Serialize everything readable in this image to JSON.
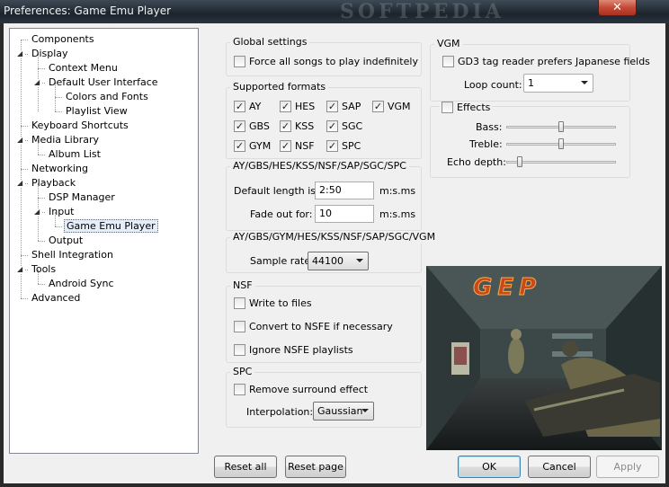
{
  "window": {
    "title": "Preferences: Game Emu Player",
    "watermark": "SOFTPEDIA",
    "close_icon": "close-icon"
  },
  "tree": {
    "items": [
      {
        "label": "Components"
      },
      {
        "label": "Display",
        "expanded": true
      },
      {
        "label": "Context Menu"
      },
      {
        "label": "Default User Interface",
        "expanded": true
      },
      {
        "label": "Colors and Fonts"
      },
      {
        "label": "Playlist View"
      },
      {
        "label": "Keyboard Shortcuts"
      },
      {
        "label": "Media Library",
        "expanded": true
      },
      {
        "label": "Album List"
      },
      {
        "label": "Networking"
      },
      {
        "label": "Playback",
        "expanded": true
      },
      {
        "label": "DSP Manager"
      },
      {
        "label": "Input",
        "expanded": true
      },
      {
        "label": "Game Emu Player",
        "selected": true
      },
      {
        "label": "Output"
      },
      {
        "label": "Shell Integration"
      },
      {
        "label": "Tools",
        "expanded": true
      },
      {
        "label": "Android Sync"
      },
      {
        "label": "Advanced"
      }
    ]
  },
  "global": {
    "title": "Global settings",
    "force_label": "Force all songs to play indefinitely",
    "force_checked": false
  },
  "formats": {
    "title": "Supported formats",
    "items": [
      {
        "label": "AY",
        "checked": true
      },
      {
        "label": "HES",
        "checked": true
      },
      {
        "label": "SAP",
        "checked": true
      },
      {
        "label": "VGM",
        "checked": true
      },
      {
        "label": "GBS",
        "checked": true
      },
      {
        "label": "KSS",
        "checked": true
      },
      {
        "label": "SGC",
        "checked": true
      },
      {
        "label": "GYM",
        "checked": true
      },
      {
        "label": "NSF",
        "checked": true
      },
      {
        "label": "SPC",
        "checked": true
      }
    ]
  },
  "length": {
    "title": "AY/GBS/HES/KSS/NSF/SAP/SGC/SPC",
    "default_label": "Default length is:",
    "default_value": "2:50",
    "fade_label": "Fade out for:",
    "fade_value": "10",
    "unit": "m:s.ms"
  },
  "rate": {
    "title": "AY/GBS/GYM/HES/KSS/NSF/SAP/SGC/VGM",
    "label": "Sample rate:",
    "value": "44100"
  },
  "nsf": {
    "title": "NSF",
    "write_label": "Write to files",
    "convert_label": "Convert to NSFE if necessary",
    "ignore_label": "Ignore NSFE playlists"
  },
  "spc": {
    "title": "SPC",
    "surround_label": "Remove surround effect",
    "interp_label": "Interpolation:",
    "interp_value": "Gaussian"
  },
  "vgm": {
    "title": "VGM",
    "gd3_label": "GD3 tag reader prefers Japanese fields",
    "loop_label": "Loop count:",
    "loop_value": "1"
  },
  "effects": {
    "title": "Effects",
    "checked": false,
    "bass_label": "Bass:",
    "bass_level": 0.5,
    "treble_label": "Treble:",
    "treble_level": 0.5,
    "echo_label": "Echo depth:",
    "echo_level": 0.1
  },
  "shot": {
    "logo": "GEP"
  },
  "buttons": {
    "reset_all": "Reset all",
    "reset_page": "Reset page",
    "ok": "OK",
    "cancel": "Cancel",
    "apply": "Apply"
  }
}
